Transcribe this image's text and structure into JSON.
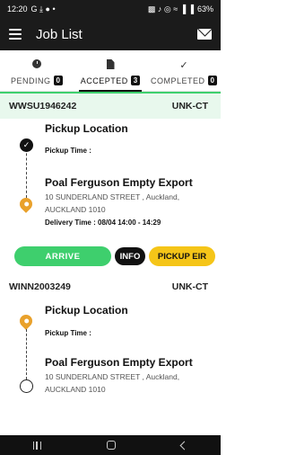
{
  "status_bar": {
    "time": "12:20",
    "left_icons": "G ⤓ ● •",
    "right_icons": "▩ ♪ ◎ ≈ ▐ ▐",
    "battery": "63%"
  },
  "app_bar": {
    "title": "Job List"
  },
  "tabs": [
    {
      "label": "PENDING",
      "count": "0"
    },
    {
      "label": "ACCEPTED",
      "count": "3"
    },
    {
      "label": "COMPLETED",
      "count": "0"
    }
  ],
  "jobs": [
    {
      "container": "WWSU1946242",
      "type": "UNK-CT",
      "pickup_title": "Pickup Location",
      "pickup_time_label": "Pickup Time :",
      "place": "Poal Ferguson Empty Export",
      "address_line1": "10 SUNDERLAND STREET , Auckland,",
      "address_line2": "AUCKLAND 1010",
      "delivery_time": "Delivery Time : 08/04 14:00 - 14:29",
      "actions": {
        "arrive": "ARRIVE",
        "info": "INFO",
        "pickup_eir": "PICKUP EIR"
      }
    },
    {
      "container": "WINN2003249",
      "type": "UNK-CT",
      "pickup_title": "Pickup Location",
      "pickup_time_label": "Pickup Time :",
      "place": "Poal Ferguson Empty Export",
      "address_line1": "10 SUNDERLAND STREET , Auckland,",
      "address_line2": "AUCKLAND 1010"
    }
  ],
  "icons": {
    "menu": "menu-icon",
    "mail": "mail-icon",
    "pending": "clock-icon",
    "accepted": "document-icon",
    "completed": "check-icon",
    "done": "check-circle-icon",
    "location": "location-pin-icon"
  },
  "colors": {
    "app_bar": "#1b1b1b",
    "arrive": "#3ecf6d",
    "info": "#111111",
    "pickup_eir": "#f5c518",
    "pin": "#e9a12b",
    "selected_bg": "#e8f8ed"
  }
}
